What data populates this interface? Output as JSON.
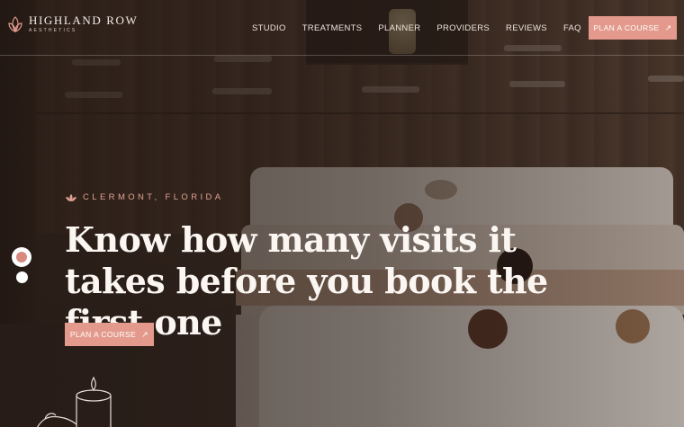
{
  "brand": {
    "name": "HIGHLAND ROW",
    "sub": "AESTHETICS"
  },
  "nav": [
    {
      "label": "STUDIO"
    },
    {
      "label": "TREATMENTS"
    },
    {
      "label": "PLANNER"
    },
    {
      "label": "PROVIDERS"
    },
    {
      "label": "REVIEWS"
    },
    {
      "label": "FAQ"
    }
  ],
  "header_cta": {
    "label": "PLAN A COURSE",
    "icon": "arrow-up-right-icon"
  },
  "hero": {
    "eyebrow": "CLERMONT, FLORIDA",
    "eyebrow_icon": "lotus-icon",
    "headline": "Know how many visits it takes before you book the first one",
    "cta": {
      "label": "PLAN A COURSE",
      "icon": "arrow-up-right-icon"
    }
  },
  "slider": {
    "active_index": 0,
    "total": 2
  },
  "colors": {
    "accent": "#e39a8c",
    "eyebrow": "#e3a193",
    "headline": "#fbf6f2"
  }
}
